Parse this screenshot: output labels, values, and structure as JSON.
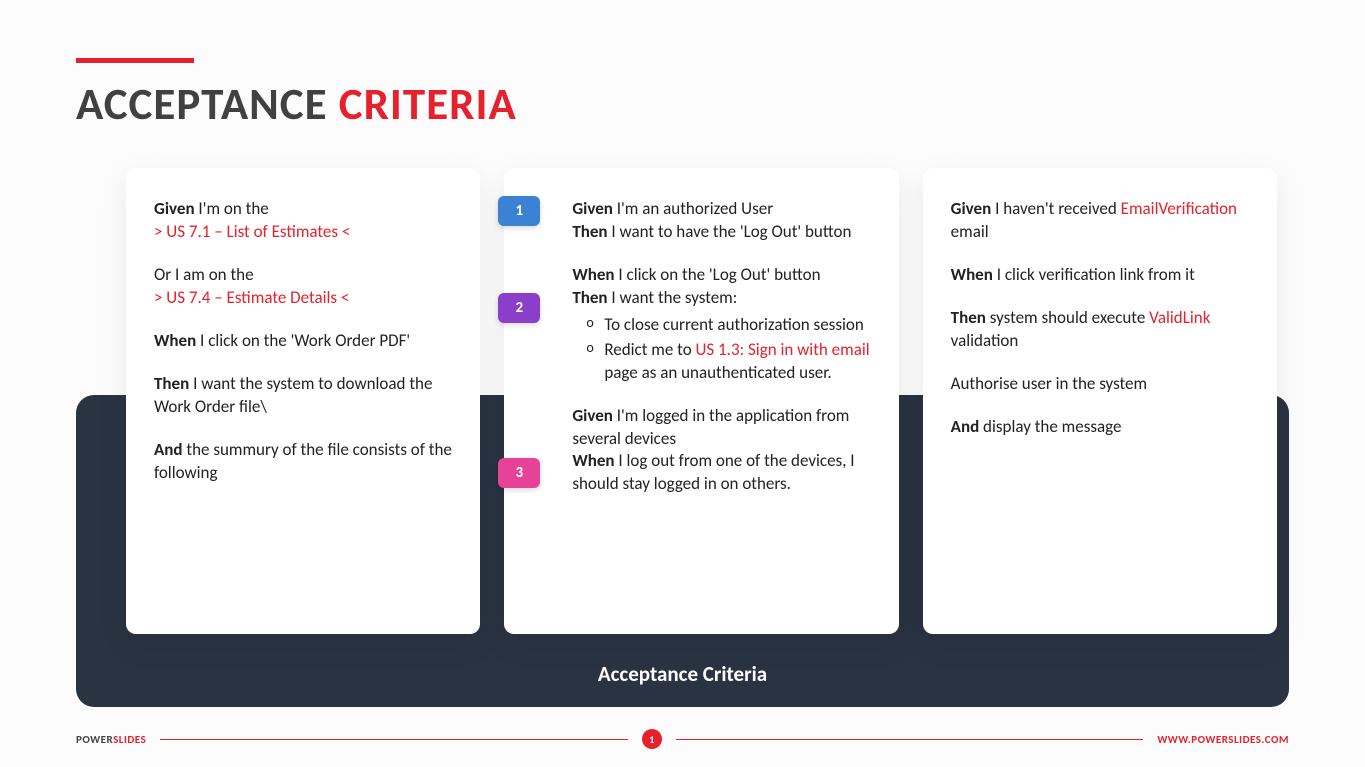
{
  "title": {
    "word1": "ACCEPTANCE",
    "word2": "CRITERIA"
  },
  "darkPanel": {
    "label": "Acceptance Criteria"
  },
  "col1": {
    "p1_a": "Given",
    "p1_b": " I'm on the",
    "p1_link": "> US 7.1 – List of Estimates <",
    "p2_a": "Or I am on the",
    "p2_link": "> US 7.4 – Estimate Details <",
    "p3_a": "When",
    "p3_b": " I click on the 'Work Order PDF'",
    "p4_a": "Then",
    "p4_b": " I want the system to download the Work Order file\\",
    "p5_a": "And",
    "p5_b": " the summury of the file consists of the following"
  },
  "col2": {
    "badge1": "1",
    "badge2": "2",
    "badge3": "3",
    "s1_l1a": "Given",
    "s1_l1b": " I'm an authorized User",
    "s1_l2a": "Then",
    "s1_l2b": " I want to have the 'Log Out' button",
    "s2_l1a": "When",
    "s2_l1b": " I click on the 'Log Out' button",
    "s2_l2a": "Then",
    "s2_l2b": " I want the system:",
    "s2_b1": "To close current authorization session",
    "s2_b2a": "Redict me to ",
    "s2_b2link": "US 1.3: Sign in with email",
    "s2_b2b": " page as an unauthenticated user.",
    "s3_l1a": "Given",
    "s3_l1b": " I'm logged in the application from several devices",
    "s3_l2a": "When",
    "s3_l2b": " I log out from one of the devices, I should stay logged in on others."
  },
  "col3": {
    "p1_a": "Given",
    "p1_b": " I haven't received ",
    "p1_link": "EmailVerification",
    "p1_c": " email",
    "p2_a": "When",
    "p2_b": " I click verification link from it",
    "p3_a": "Then",
    "p3_b": " system should execute ",
    "p3_link": "ValidLink",
    "p3_c": " validation",
    "p4": "Authorise user in the system",
    "p5_a": "And",
    "p5_b": " display the message"
  },
  "footer": {
    "brand1": "POWER",
    "brand2": "SLIDES",
    "page": "1",
    "url": "WWW.POWERSLIDES.COM"
  }
}
